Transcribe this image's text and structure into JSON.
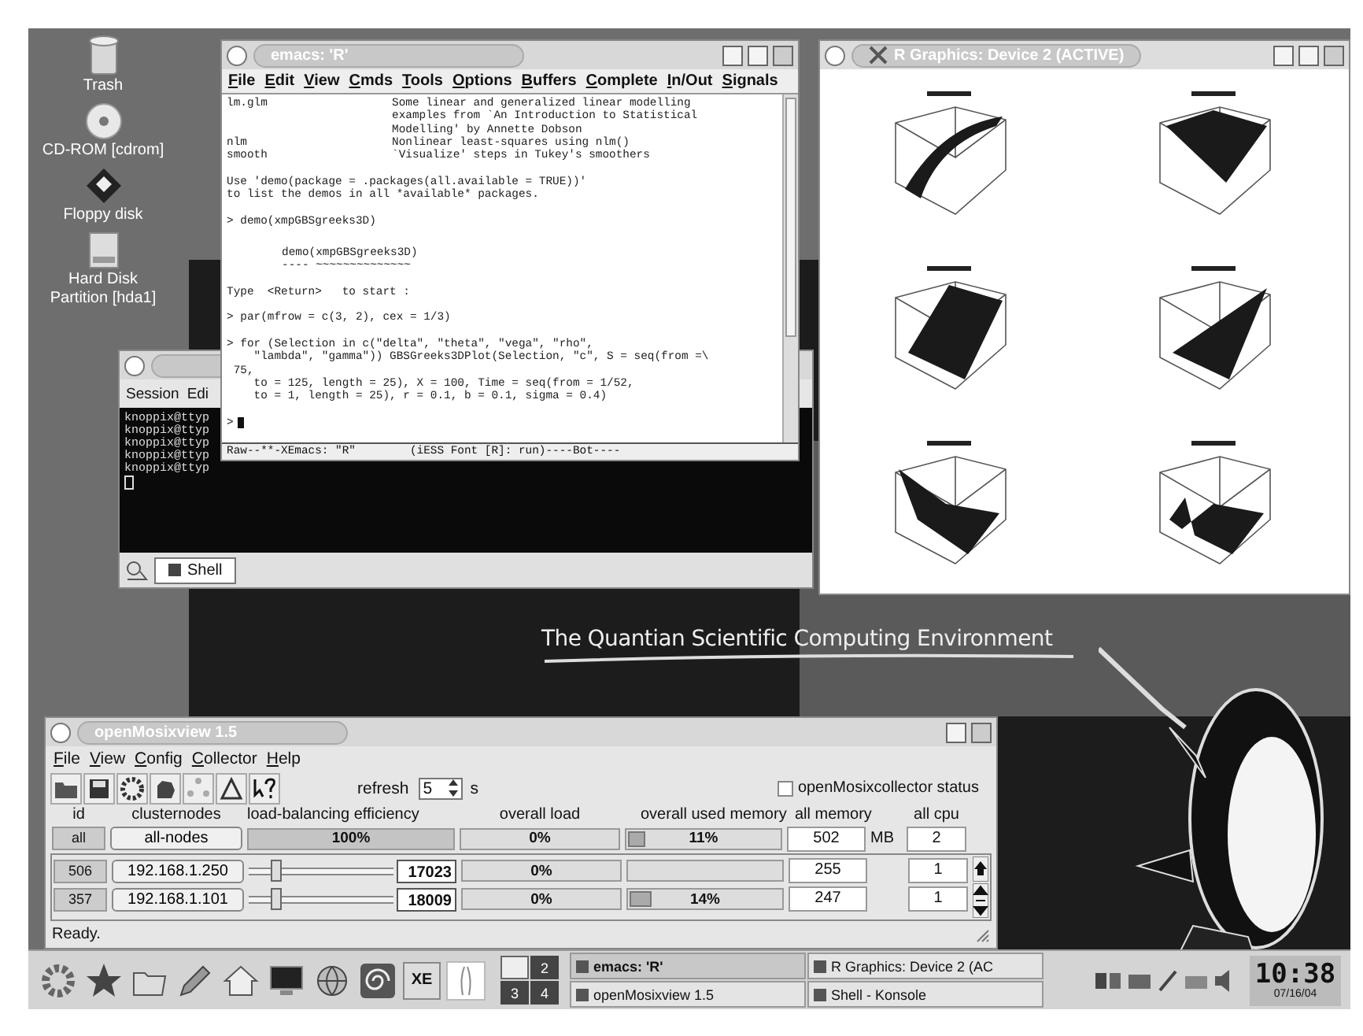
{
  "desktop_icons": [
    {
      "label": "Trash",
      "kind": "trash"
    },
    {
      "label": "CD-ROM [cdrom]",
      "kind": "cdrom"
    },
    {
      "label": "Floppy disk",
      "kind": "floppy"
    },
    {
      "label": "Hard Disk Partition [hda1]",
      "kind": "harddisk"
    }
  ],
  "banner": "The Quantian Scientific Computing Environment",
  "konsole": {
    "menu": [
      "Session",
      "Edi"
    ],
    "lines": [
      "knoppix@ttyp",
      "knoppix@ttyp",
      "knoppix@ttyp",
      "knoppix@ttyp",
      "knoppix@ttyp"
    ],
    "tabs": [
      {
        "label": "Shell",
        "selected": true
      }
    ]
  },
  "emacs": {
    "title": "emacs: 'R'",
    "menu": [
      "File",
      "Edit",
      "View",
      "Cmds",
      "Tools",
      "Options",
      "Buffers",
      "Complete",
      "In/Out",
      "Signals"
    ],
    "listing": [
      {
        "name": "lm.glm",
        "desc": "Some linear and generalized linear modelling"
      },
      {
        "desc": "examples from `An Introduction to Statistical"
      },
      {
        "desc": "Modelling' by Annette Dobson"
      },
      {
        "name": "nlm",
        "desc": "Nonlinear least-squares using nlm()"
      },
      {
        "name": "smooth",
        "desc": "`Visualize' steps in Tukey's smoothers"
      }
    ],
    "blocks": [
      {
        "kind": "text",
        "lines": [
          "Use 'demo(package = .packages(all.available = TRUE))'",
          "to list the demos in all *available* packages."
        ]
      },
      {
        "kind": "text",
        "lines": [
          "> demo(xmpGBSgreeks3D)"
        ]
      },
      {
        "kind": "heading",
        "lines": [
          "demo(xmpGBSgreeks3D)",
          "---- ~~~~~~~~~~~~~~"
        ]
      },
      {
        "kind": "text",
        "lines": [
          "Type  <Return>   to start :"
        ]
      },
      {
        "kind": "text",
        "lines": [
          "> par(mfrow = c(3, 2), cex = 1/3)"
        ]
      },
      {
        "kind": "text",
        "lines": [
          "> for (Selection in c(\"delta\", \"theta\", \"vega\", \"rho\",",
          "    \"lambda\", \"gamma\")) GBSGreeks3DPlot(Selection, \"c\", S = seq(from =\\",
          " 75,",
          "    to = 125, length = 25), X = 100, Time = seq(from = 1/52,",
          "    to = 1, length = 25), r = 0.1, b = 0.1, sigma = 0.4)"
        ]
      },
      {
        "kind": "prompt",
        "lines": [
          ">"
        ]
      }
    ],
    "mode_line": "Raw--**-XEmacs: \"R\"        (iESS Font [R]: run)----Bot----"
  },
  "rgraphics": {
    "title": "R Graphics: Device 2 (ACTIVE)"
  },
  "mosix": {
    "title": "openMosixview 1.5",
    "menu": [
      "File",
      "View",
      "Config",
      "Collector",
      "Help"
    ],
    "refresh_label": "refresh",
    "refresh_value": "5",
    "refresh_unit": "s",
    "collector": {
      "label": "openMosixcollector status",
      "checked": false
    },
    "columns": [
      "id",
      "clusternodes",
      "load-balancing efficiency",
      "overall load",
      "overall used memory",
      "all memory",
      "all cpu"
    ],
    "all_row": {
      "id": "all",
      "node": "all-nodes",
      "efficiency": "100%",
      "level": 1.0,
      "load": "0%",
      "memory": {
        "text": "11%",
        "level": 0.11
      },
      "all_memory": "502",
      "unit": "MB",
      "cpu": "2"
    },
    "nodes": [
      {
        "id": "506",
        "node": "192.168.1.250",
        "level": 0.15,
        "speed": "17023",
        "load": "0%",
        "all_memory": "255",
        "cpu": "1"
      },
      {
        "id": "357",
        "node": "192.168.1.101",
        "level": 0.15,
        "speed": "18009",
        "load": "0%",
        "memory": {
          "text": "14%",
          "level": 0.14
        },
        "all_memory": "247",
        "cpu": "1"
      }
    ],
    "status": "Ready."
  },
  "taskbar": {
    "launcher_text": "XE",
    "desks": [
      {
        "selected": true
      },
      {
        "label": "2",
        "selected": false
      },
      {
        "label": "3",
        "selected": false
      },
      {
        "label": "4",
        "selected": false
      }
    ],
    "tasks": [
      {
        "title": "emacs: 'R'",
        "selected": true
      },
      {
        "title": "R Graphics: Device 2 (AC",
        "selected": false
      },
      {
        "title": "openMosixview 1.5",
        "selected": false
      },
      {
        "title": "Shell - Konsole",
        "selected": false
      }
    ],
    "clock": "10:38",
    "date": "07/16/04"
  }
}
